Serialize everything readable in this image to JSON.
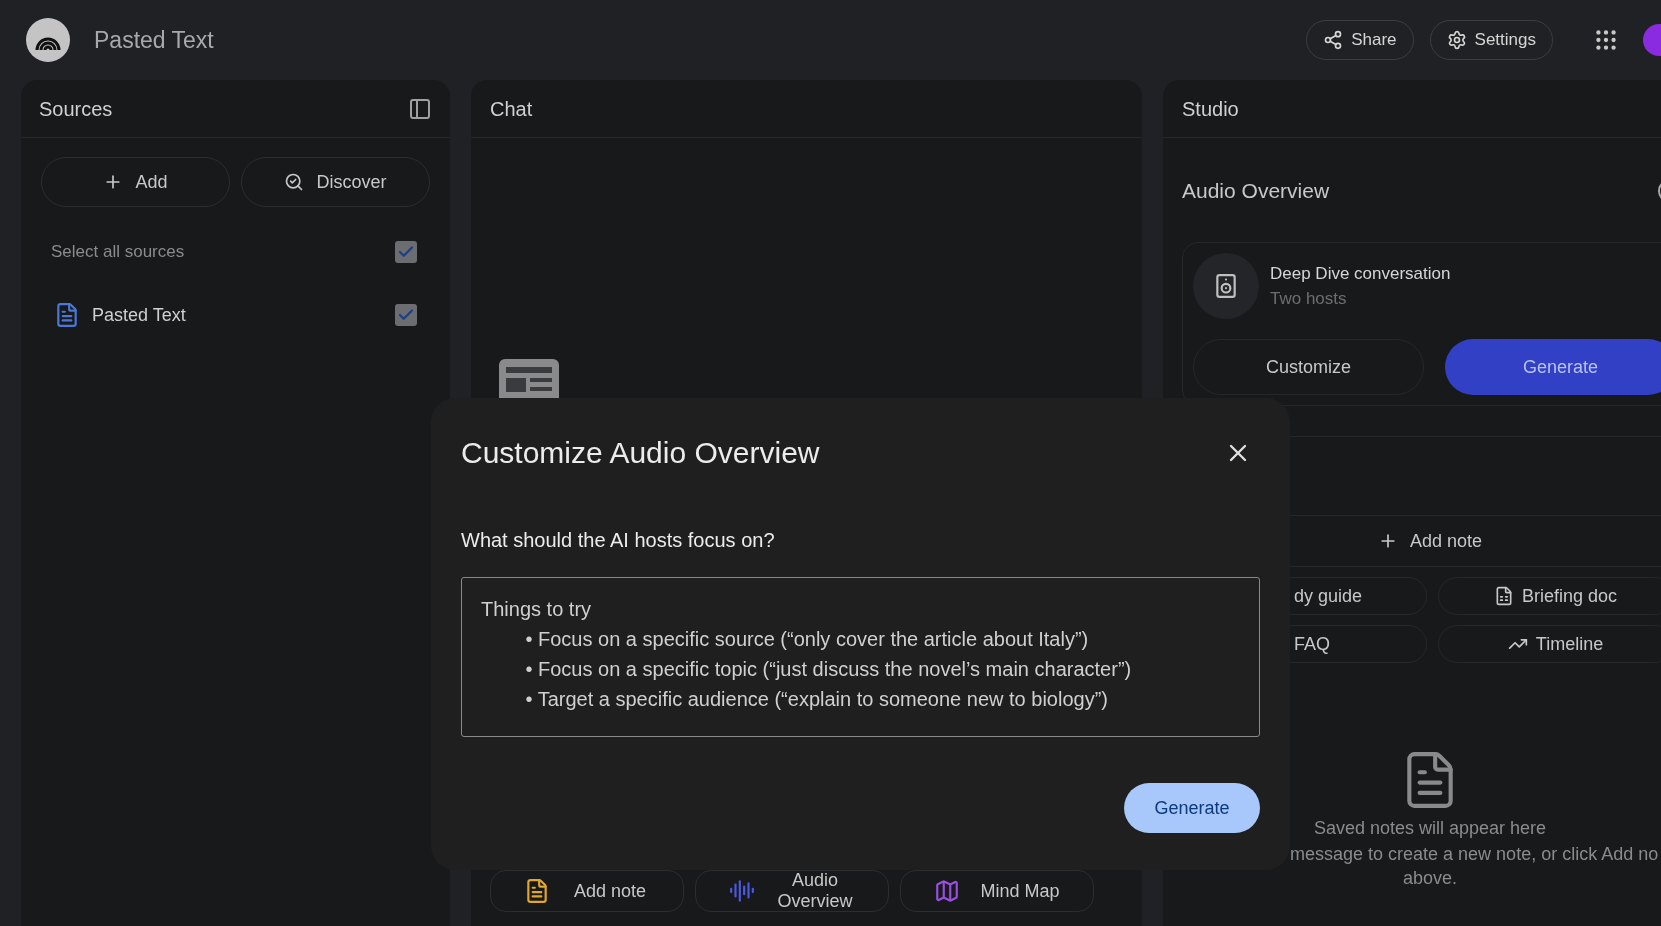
{
  "header": {
    "title": "Pasted Text",
    "buttons": [
      {
        "kind": "share",
        "label": "Share"
      },
      {
        "kind": "settings",
        "label": "Settings"
      }
    ]
  },
  "sources": {
    "title": "Sources",
    "buttons": [
      {
        "kind": "add",
        "label": "Add"
      },
      {
        "kind": "discover",
        "label": "Discover"
      }
    ],
    "select_all": {
      "label": "Select all sources",
      "checked": true
    },
    "items": [
      {
        "title": "Pasted Text",
        "checked": true
      }
    ]
  },
  "chat": {
    "title": "Chat",
    "actions": [
      {
        "kind": "note",
        "label": "Add note"
      },
      {
        "kind": "audio",
        "label": "Audio Overview"
      },
      {
        "kind": "map",
        "label": "Mind Map"
      }
    ]
  },
  "studio": {
    "title": "Studio",
    "section": "Audio Overview",
    "audio_card": {
      "title": "Deep Dive conversation",
      "subtitle": "Two hosts",
      "buttons": [
        {
          "kind": "outline",
          "label": "Customize"
        },
        {
          "kind": "primary",
          "label": "Generate"
        }
      ]
    },
    "add_note": "Add note",
    "tools": [
      {
        "kind": "none",
        "label": "dy guide"
      },
      {
        "kind": "briefing",
        "label": "Briefing doc"
      },
      {
        "kind": "none",
        "label": "FAQ"
      },
      {
        "kind": "timeline",
        "label": "Timeline"
      }
    ],
    "empty_title": "Saved notes will appear here",
    "empty_lines": [
      "message to create a new note, or click Add no",
      "above."
    ]
  },
  "dialog": {
    "title": "Customize Audio Overview",
    "question": "What should the AI hosts focus on?",
    "placeholder_title": "Things to try",
    "hints": [
      "• Focus on a specific source (“only cover the article about Italy”)",
      "• Focus on a specific topic (“just discuss the novel’s main character”)",
      "• Target a specific audience (“explain to someone new to biology”)"
    ],
    "button": "Generate"
  }
}
